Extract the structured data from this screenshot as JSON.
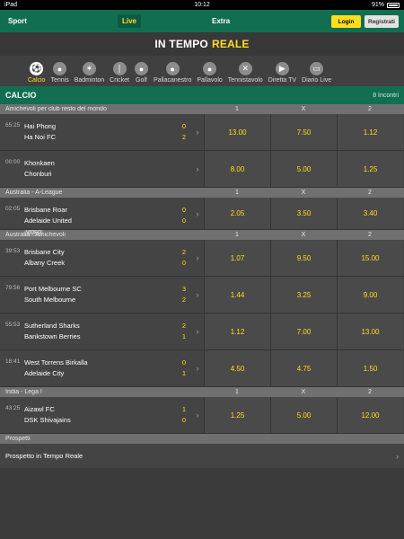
{
  "status": {
    "device": "iPad",
    "time": "10:12",
    "battery": "91%"
  },
  "nav": {
    "sport": "Sport",
    "live": "Live",
    "extra": "Extra",
    "login": "Login",
    "register": "Registrati"
  },
  "hero": {
    "white": "IN TEMPO",
    "yellow": "REALE"
  },
  "sports": [
    {
      "label": "Calcio",
      "icon": "soccer-ball-icon",
      "glyph": "⚽",
      "active": true
    },
    {
      "label": "Tennis",
      "icon": "tennis-ball-icon",
      "glyph": "●"
    },
    {
      "label": "Badminton",
      "icon": "shuttlecock-icon",
      "glyph": "✶"
    },
    {
      "label": "Cricket",
      "icon": "cricket-icon",
      "glyph": "❘"
    },
    {
      "label": "Golf",
      "icon": "golf-ball-icon",
      "glyph": "●"
    },
    {
      "label": "Pallacanestro",
      "icon": "basketball-icon",
      "glyph": "●"
    },
    {
      "label": "Pallavolo",
      "icon": "volleyball-icon",
      "glyph": "●"
    },
    {
      "label": "Tennistavolo",
      "icon": "table-tennis-icon",
      "glyph": "✕"
    },
    {
      "label": "Diretta TV",
      "icon": "play-tv-icon",
      "glyph": "▶"
    },
    {
      "label": "Diario Live",
      "icon": "diary-icon",
      "glyph": "▭"
    }
  ],
  "section": {
    "title": "CALCIO",
    "count": "8 Incontri"
  },
  "groups": [
    {
      "name": "Amichevoli per club resto del mondo",
      "cols": [
        "1",
        "X",
        "2"
      ],
      "matches": [
        {
          "time": "65:25",
          "home": "Hai Phong",
          "away": "Ha Noi FC",
          "sh": "0",
          "sa": "2",
          "o1": "13.00",
          "ox": "7.50",
          "o2": "1.12"
        },
        {
          "time": "00:00",
          "home": "Khonkaen",
          "away": "Chonburi",
          "sh": "",
          "sa": "",
          "o1": "8.00",
          "ox": "5.00",
          "o2": "1.25"
        }
      ]
    },
    {
      "name": "Australia - A-League",
      "cols": [
        "1",
        "X",
        "2"
      ],
      "matches": [
        {
          "time": "02:05",
          "home": "Brisbane Roar",
          "away": "Adelaide United",
          "sh": "0",
          "sa": "0",
          "o1": "2.05",
          "ox": "3.50",
          "o2": "3.40",
          "video": "VIDEO"
        }
      ]
    },
    {
      "name": "Australia - Amichevoli",
      "cols": [
        "1",
        "X",
        "2"
      ],
      "matches": [
        {
          "time": "39:53",
          "home": "Brisbane City",
          "away": "Albany Creek",
          "sh": "2",
          "sa": "0",
          "o1": "1.07",
          "ox": "9.50",
          "o2": "15.00"
        },
        {
          "time": "79:56",
          "home": "Port Melbourne SC",
          "away": "South Melbourne",
          "sh": "3",
          "sa": "2",
          "o1": "1.44",
          "ox": "3.25",
          "o2": "9.00"
        },
        {
          "time": "55:53",
          "home": "Sutherland Sharks",
          "away": "Bankstown Berries",
          "sh": "2",
          "sa": "1",
          "o1": "1.12",
          "ox": "7.00",
          "o2": "13.00"
        },
        {
          "time": "18:41",
          "home": "West Torrens Birkalla",
          "away": "Adelaide City",
          "sh": "0",
          "sa": "1",
          "o1": "4.50",
          "ox": "4.75",
          "o2": "1.50"
        }
      ]
    },
    {
      "name": "India - Lega I",
      "cols": [
        "1",
        "X",
        "2"
      ],
      "matches": [
        {
          "time": "43:25",
          "home": "Aizawl FC",
          "away": "DSK Shivajains",
          "sh": "1",
          "sa": "0",
          "o1": "1.25",
          "ox": "5.00",
          "o2": "12.00"
        }
      ]
    }
  ],
  "prospects": {
    "title": "Prospetti",
    "link": "Prospetto in Tempo Reale"
  }
}
